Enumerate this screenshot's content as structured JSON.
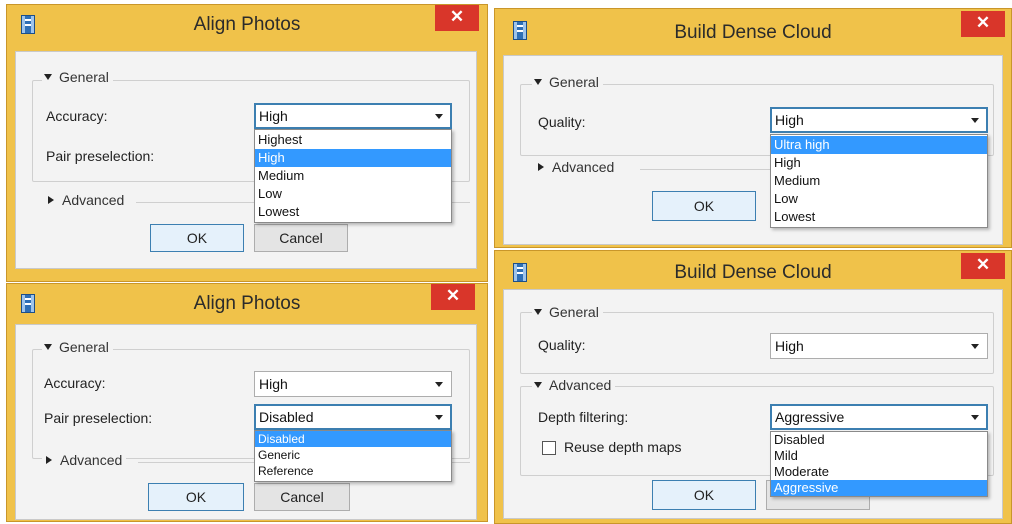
{
  "align_photos_accuracy": {
    "title": "Align Photos",
    "close": "✕",
    "general": "General",
    "accuracy_label": "Accuracy:",
    "accuracy_value": "High",
    "pair_label": "Pair preselection:",
    "accuracy_options": [
      "Highest",
      "High",
      "Medium",
      "Low",
      "Lowest"
    ],
    "advanced": "Advanced",
    "ok": "OK",
    "cancel": "Cancel"
  },
  "align_photos_pair": {
    "title": "Align Photos",
    "close": "✕",
    "general": "General",
    "accuracy_label": "Accuracy:",
    "accuracy_value": "High",
    "pair_label": "Pair preselection:",
    "pair_value": "Disabled",
    "pair_options": [
      "Disabled",
      "Generic",
      "Reference"
    ],
    "advanced": "Advanced",
    "ok": "OK",
    "cancel": "Cancel"
  },
  "dense_cloud_quality": {
    "title": "Build Dense Cloud",
    "close": "✕",
    "general": "General",
    "quality_label": "Quality:",
    "quality_value": "High",
    "quality_options": [
      "Ultra high",
      "High",
      "Medium",
      "Low",
      "Lowest"
    ],
    "advanced": "Advanced",
    "ok": "OK"
  },
  "dense_cloud_depth": {
    "title": "Build Dense Cloud",
    "close": "✕",
    "general": "General",
    "quality_label": "Quality:",
    "quality_value": "High",
    "advanced": "Advanced",
    "depth_label": "Depth filtering:",
    "depth_value": "Aggressive",
    "depth_options": [
      "Disabled",
      "Mild",
      "Moderate",
      "Aggressive"
    ],
    "reuse_label": "Reuse depth maps",
    "reuse_checked": false,
    "ok": "OK"
  },
  "colors": {
    "frame": "#f0c24a",
    "close": "#d9362a",
    "selection": "#3399ff",
    "focus_border": "#3c7fb1"
  },
  "icons": {
    "app": "app-icon",
    "close": "close-icon",
    "expanded": "triangle-down-icon",
    "collapsed": "triangle-right-icon",
    "dropdown": "chevron-down-icon"
  }
}
